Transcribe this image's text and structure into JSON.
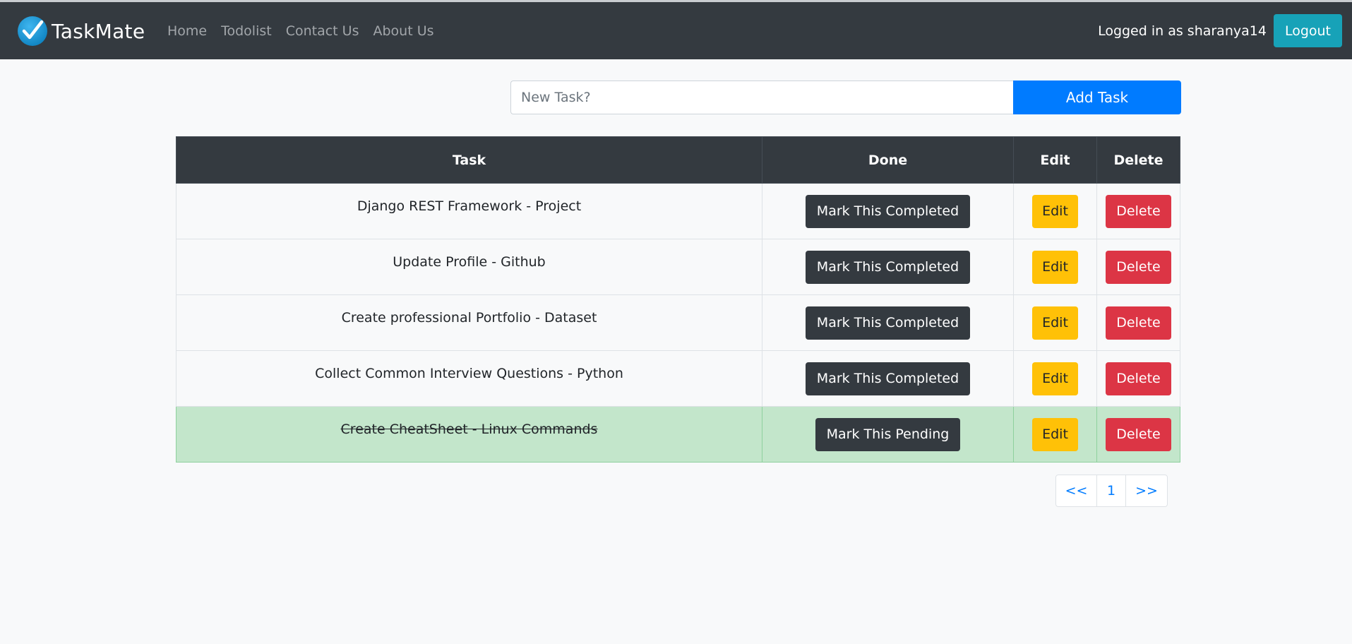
{
  "navbar": {
    "brand": "TaskMate",
    "links": [
      "Home",
      "Todolist",
      "Contact Us",
      "About Us"
    ],
    "user_text": "Logged in as sharanya14",
    "logout_label": "Logout"
  },
  "add_form": {
    "placeholder": "New Task?",
    "value": "",
    "button_label": "Add Task"
  },
  "table": {
    "headers": [
      "Task",
      "Done",
      "Edit",
      "Delete"
    ],
    "rows": [
      {
        "task": "Django REST Framework - Project",
        "done_label": "Mark This Completed",
        "edit_label": "Edit",
        "delete_label": "Delete",
        "completed": false
      },
      {
        "task": "Update Profile - Github",
        "done_label": "Mark This Completed",
        "edit_label": "Edit",
        "delete_label": "Delete",
        "completed": false
      },
      {
        "task": "Create professional Portfolio - Dataset",
        "done_label": "Mark This Completed",
        "edit_label": "Edit",
        "delete_label": "Delete",
        "completed": false
      },
      {
        "task": "Collect Common Interview Questions - Python",
        "done_label": "Mark This Completed",
        "edit_label": "Edit",
        "delete_label": "Delete",
        "completed": false
      },
      {
        "task": "Create CheatSheet - Linux Commands",
        "done_label": "Mark This Pending",
        "edit_label": "Edit",
        "delete_label": "Delete",
        "completed": true
      }
    ]
  },
  "pagination": {
    "prev": "<<",
    "current": "1",
    "next": ">>"
  },
  "colors": {
    "navbar": "#343a40",
    "primary": "#007bff",
    "info": "#17a2b8",
    "warning": "#ffc107",
    "danger": "#dc3545",
    "success_row": "#c3e6cb"
  },
  "icons": {
    "brand": "checkmark-circle-icon"
  }
}
